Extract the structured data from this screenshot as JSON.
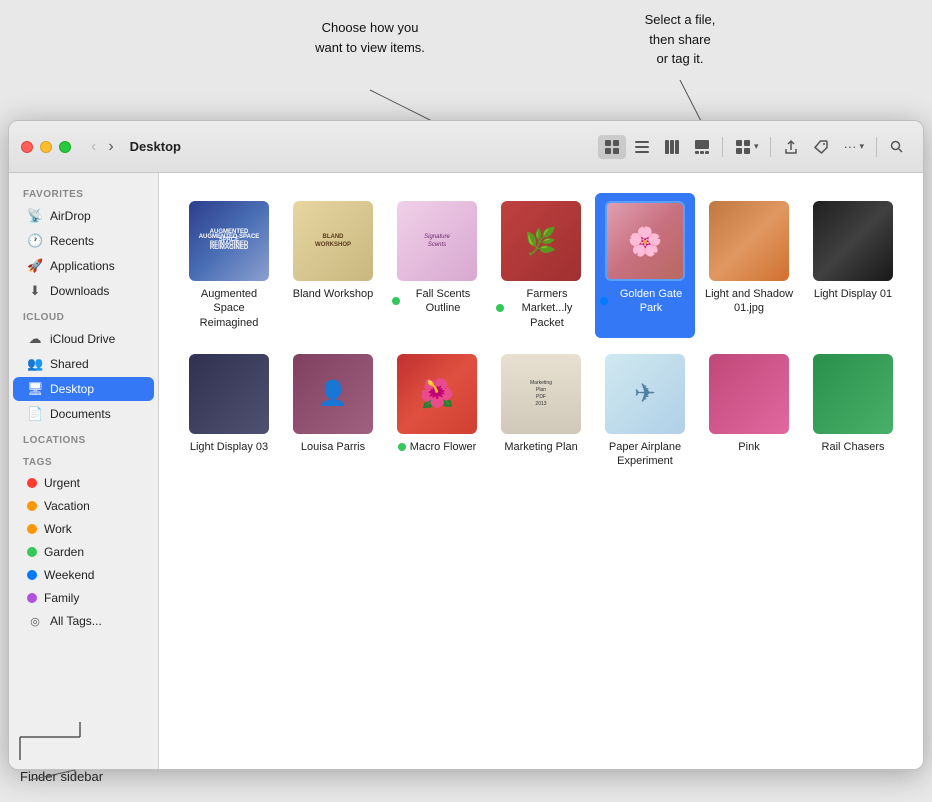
{
  "window": {
    "title": "Desktop"
  },
  "toolbar": {
    "back_label": "‹",
    "forward_label": "›",
    "view_icon": "⊞",
    "view_list": "≡",
    "view_column": "⊟",
    "view_gallery": "⊡",
    "group_label": "⊞⊞",
    "share_label": "↑",
    "tag_label": "🏷",
    "more_label": "···",
    "search_label": "🔍"
  },
  "sidebar": {
    "favorites_label": "Favorites",
    "icloud_label": "iCloud",
    "locations_label": "Locations",
    "tags_label": "Tags",
    "items": [
      {
        "id": "airdrop",
        "label": "AirDrop",
        "icon": "📡"
      },
      {
        "id": "recents",
        "label": "Recents",
        "icon": "🕐"
      },
      {
        "id": "applications",
        "label": "Applications",
        "icon": "🚀"
      },
      {
        "id": "downloads",
        "label": "Downloads",
        "icon": "⬇"
      },
      {
        "id": "icloud-drive",
        "label": "iCloud Drive",
        "icon": "☁"
      },
      {
        "id": "shared",
        "label": "Shared",
        "icon": "👥"
      },
      {
        "id": "desktop",
        "label": "Desktop",
        "icon": "🖥",
        "active": true
      },
      {
        "id": "documents",
        "label": "Documents",
        "icon": "📄"
      }
    ],
    "tags": [
      {
        "id": "urgent",
        "label": "Urgent",
        "color": "#ff3b30"
      },
      {
        "id": "vacation",
        "label": "Vacation",
        "color": "#ff9500"
      },
      {
        "id": "work",
        "label": "Work",
        "color": "#ff9500"
      },
      {
        "id": "garden",
        "label": "Garden",
        "color": "#34c759"
      },
      {
        "id": "weekend",
        "label": "Weekend",
        "color": "#007aff"
      },
      {
        "id": "family",
        "label": "Family",
        "color": "#af52de"
      },
      {
        "id": "all-tags",
        "label": "All Tags...",
        "icon": "◎"
      }
    ]
  },
  "files": [
    {
      "id": "augmented",
      "name": "Augmented Space Reimagined",
      "thumb": "augmented",
      "dot": null
    },
    {
      "id": "bland",
      "name": "Bland Workshop",
      "thumb": "bland",
      "dot": null
    },
    {
      "id": "fallscents",
      "name": "Fall Scents Outline",
      "thumb": "fallscents",
      "dot": "#34c759"
    },
    {
      "id": "farmers",
      "name": "Farmers Market...ly Packet",
      "thumb": "farmers",
      "dot": "#34c759"
    },
    {
      "id": "goldengate",
      "name": "Golden Gate Park",
      "thumb": "goldgate",
      "dot": "#007aff",
      "selected": true
    },
    {
      "id": "lightandshadow",
      "name": "Light and Shadow 01.jpg",
      "thumb": "lightandshadow",
      "dot": null
    },
    {
      "id": "lightdisplay01",
      "name": "Light Display 01",
      "thumb": "lightdisplay01",
      "dot": null
    },
    {
      "id": "lightdisplay03",
      "name": "Light Display 03",
      "thumb": "lightdisplay03",
      "dot": null
    },
    {
      "id": "louisa",
      "name": "Louisa Parris",
      "thumb": "louisa",
      "dot": null
    },
    {
      "id": "macro",
      "name": "Macro Flower",
      "thumb": "macro",
      "dot": "#34c759"
    },
    {
      "id": "marketing",
      "name": "Marketing Plan",
      "thumb": "marketing",
      "dot": null
    },
    {
      "id": "paper",
      "name": "Paper Airplane Experiment",
      "thumb": "paper",
      "dot": null
    },
    {
      "id": "pink",
      "name": "Pink",
      "thumb": "pink",
      "dot": null
    },
    {
      "id": "rail",
      "name": "Rail Chasers",
      "thumb": "rail",
      "dot": null
    }
  ],
  "annotations": {
    "callout1_title": "Choose how you\nwant to view items.",
    "callout2_title": "Select a file,\nthen share\nor tag it.",
    "sidebar_label": "Finder sidebar"
  }
}
